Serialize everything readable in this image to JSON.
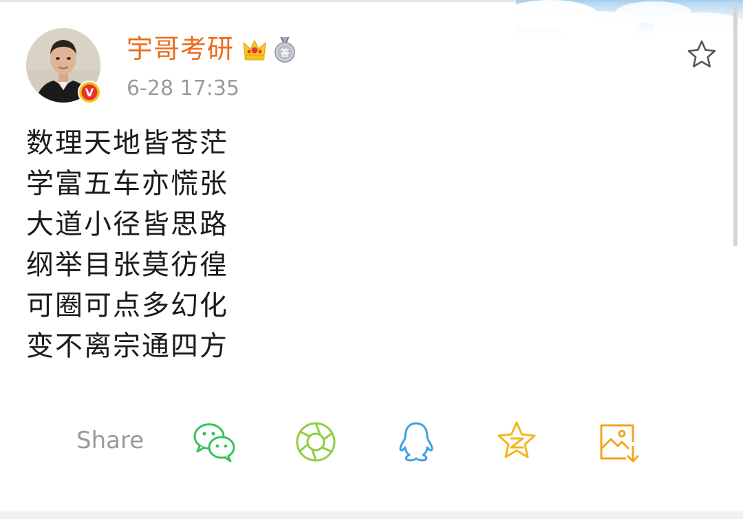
{
  "post": {
    "author": "宇哥考研",
    "timestamp": "6-28 17:35",
    "verified_badge": "V",
    "medal_badge": "答",
    "lines": [
      "数理天地皆苍茫",
      "学富五车亦慌张",
      "大道小径皆思路",
      "纲举目张莫彷徨",
      "可圈可点多幻化",
      "变不离宗通四方"
    ]
  },
  "icons": {
    "favorite": "star-outline-icon",
    "crown": "crown-icon",
    "medal": "medal-icon",
    "verified": "verified-badge-icon"
  },
  "share": {
    "label": "Share",
    "targets": [
      {
        "id": "wechat",
        "icon": "wechat-icon",
        "color": "#35c25a"
      },
      {
        "id": "moments",
        "icon": "wechat-moments-icon",
        "color": "#8fce41"
      },
      {
        "id": "qq",
        "icon": "qq-icon",
        "color": "#3fa0e2"
      },
      {
        "id": "qzone",
        "icon": "qzone-icon",
        "color": "#f3b61a"
      },
      {
        "id": "save-image",
        "icon": "save-image-icon",
        "color": "#f2a51c"
      }
    ]
  },
  "colors": {
    "author": "#ec6b1a",
    "timestamp": "#9b9b9b",
    "body_text": "#1a1a1a",
    "share_label": "#9a9a9a"
  }
}
